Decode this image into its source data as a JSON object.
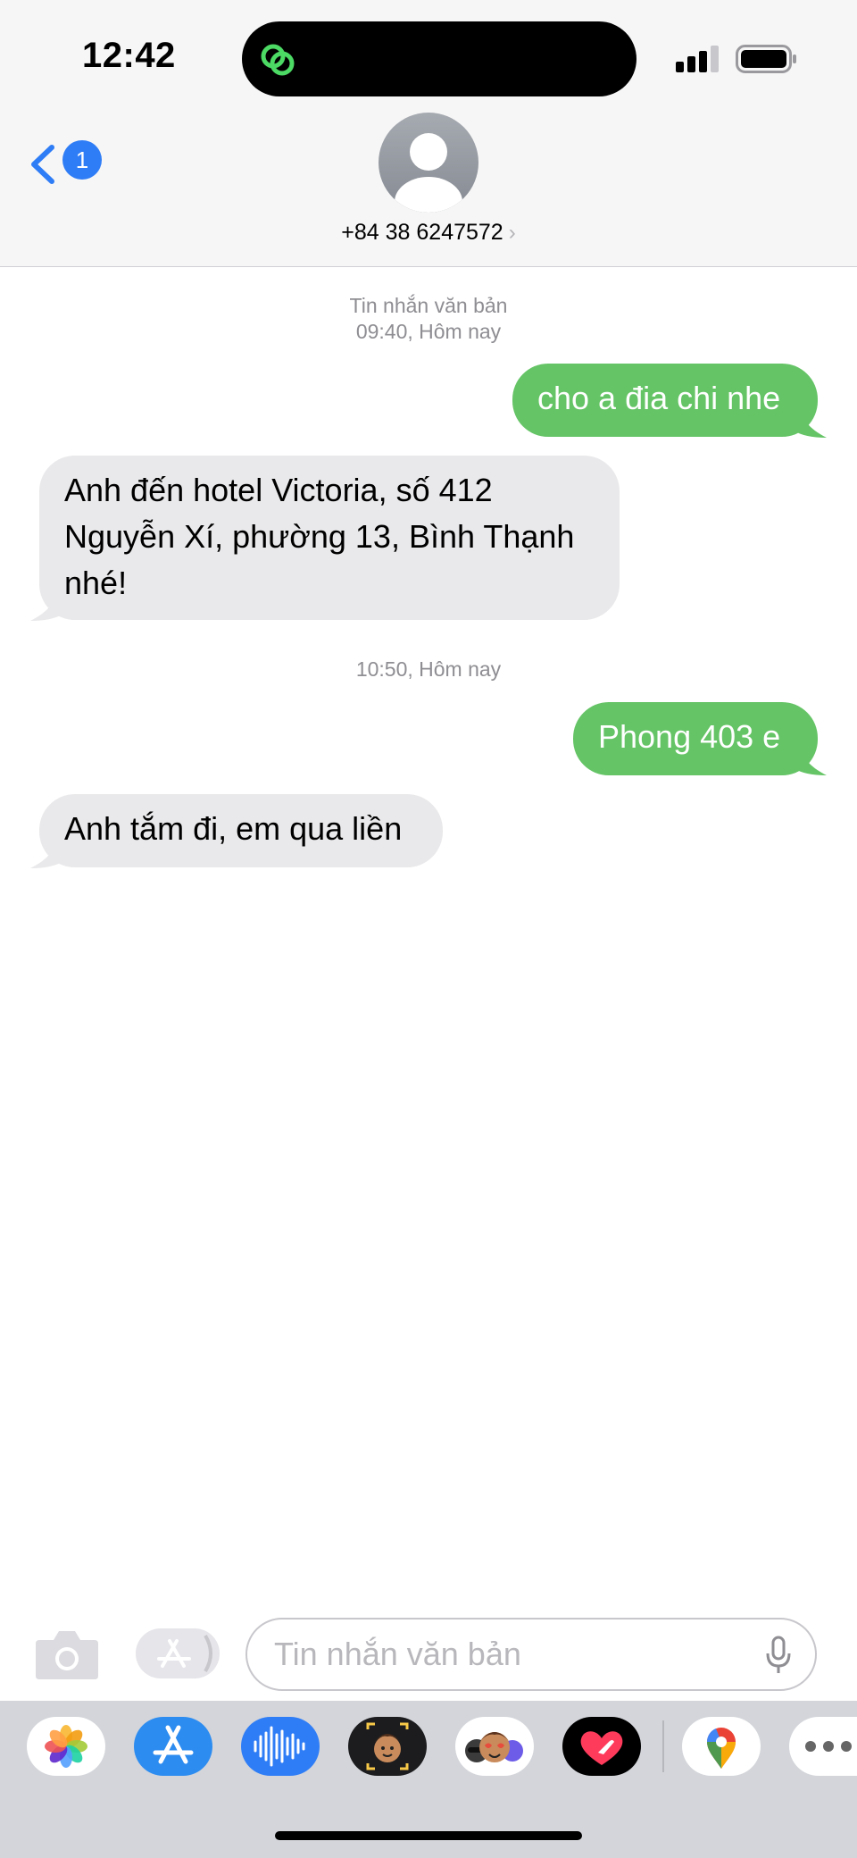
{
  "status_bar": {
    "time": "12:42"
  },
  "header": {
    "back_badge": "1",
    "contact_number": "+84 38 6247572"
  },
  "conversation": {
    "meta_type": "Tin nhắn văn bản",
    "meta_time_1": "09:40, Hôm nay",
    "meta_time_2": "10:50, Hôm nay",
    "messages": [
      {
        "direction": "outgoing",
        "text": "cho a đia chi nhe"
      },
      {
        "direction": "incoming",
        "text": "Anh đến hotel Victoria, số 412 Nguyễn Xí, phường 13, Bình Thạnh nhé!"
      },
      {
        "direction": "outgoing",
        "text": "Phong 403 e"
      },
      {
        "direction": "incoming",
        "text": "Anh tắm đi, em qua liền"
      }
    ]
  },
  "input": {
    "placeholder": "Tin nhắn văn bản"
  },
  "app_tray": [
    "photos-icon",
    "app-store-icon",
    "audio-message-icon",
    "memoji-icon",
    "memoji-stickers-icon",
    "digital-touch-icon",
    "google-maps-icon",
    "more-icon"
  ],
  "colors": {
    "accent": "#2f7df6",
    "outgoing_bubble": "#65c466",
    "incoming_bubble": "#e9e9eb"
  }
}
